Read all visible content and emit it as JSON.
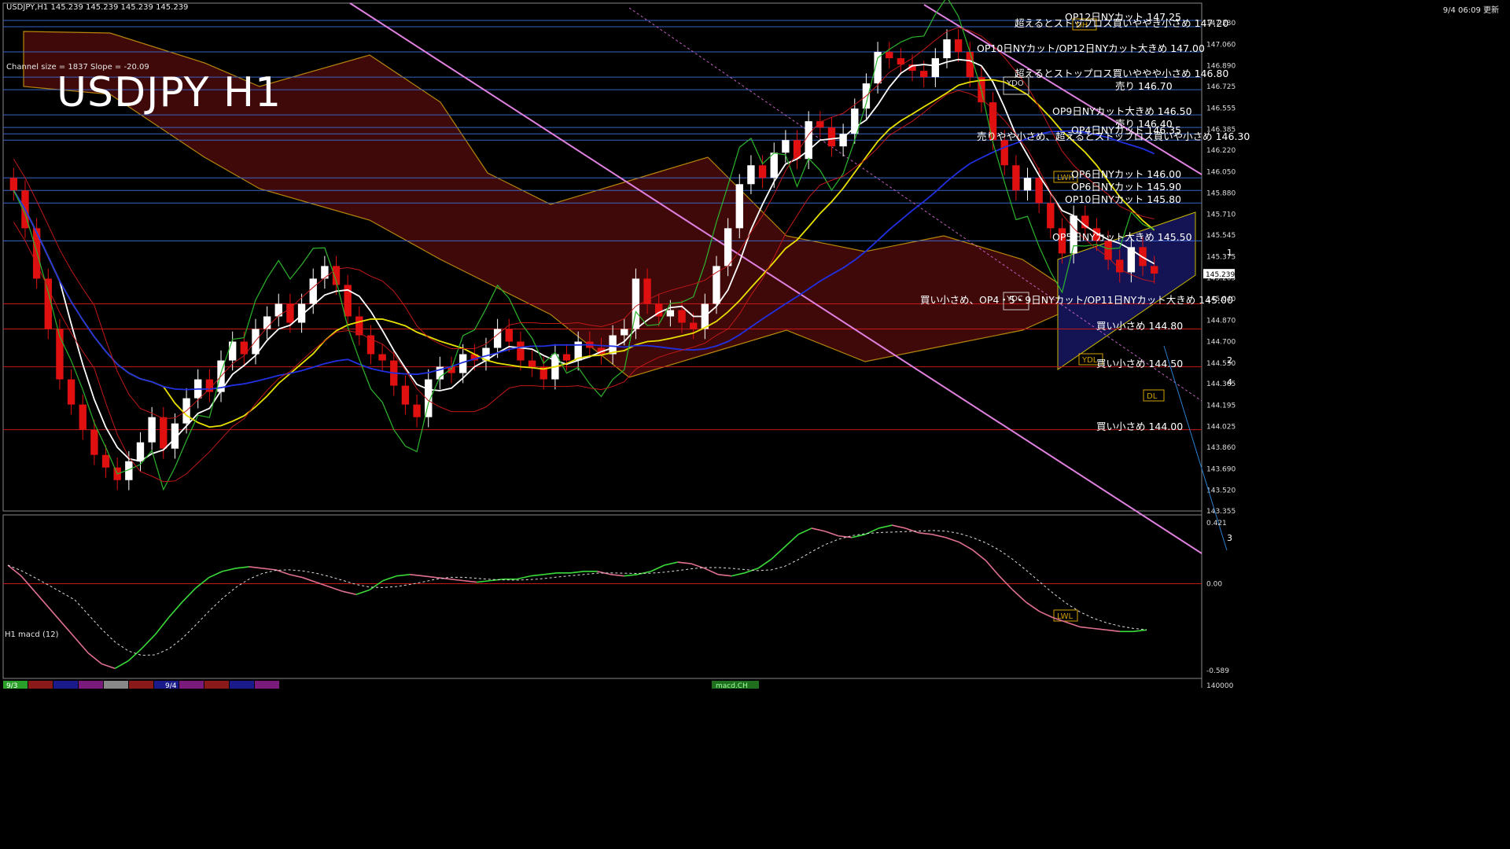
{
  "header": {
    "symbol_info": "USDJPY,H1  145.239 145.239 145.239 145.239",
    "channel_info": "Channel size = 1837 Slope = -20.09",
    "big_title": "USDJPY H1",
    "time_stamp": "9/4 06:09 更新"
  },
  "macd": {
    "label": "H1 macd (12)",
    "scale_top": "0.421",
    "scale_zero": "0.00",
    "scale_bottom": "-0.589",
    "ticks_right": "140000"
  },
  "price_axis": {
    "labels": [
      "147.230",
      "147.060",
      "146.890",
      "146.725",
      "146.555",
      "146.385",
      "146.220",
      "146.050",
      "145.880",
      "145.710",
      "145.545",
      "145.375",
      "145.205",
      "145.040",
      "144.870",
      "144.700",
      "144.530",
      "144.365",
      "144.195",
      "144.025",
      "143.860",
      "143.690",
      "143.520",
      "143.355"
    ],
    "current": "145.239"
  },
  "dates": [
    "9/3",
    "9/4"
  ],
  "bottom_tag": "macd.CH",
  "levels": [
    {
      "text": "OP12日NYカット 147.25",
      "price": 147.25
    },
    {
      "text": "超えるとストップロス買いややき小さめ 147.20",
      "price": 147.2
    },
    {
      "text": "OP10日NYカット/OP12日NYカット大きめ 147.00",
      "price": 147.0
    },
    {
      "text": "超えるとストップロス買いややや小さめ 146.80",
      "price": 146.8
    },
    {
      "text": "売り 146.70",
      "price": 146.7
    },
    {
      "text": "OP9日NYカット大きめ 146.50",
      "price": 146.5
    },
    {
      "text": "売り 146.40",
      "price": 146.4
    },
    {
      "text": "OP4日NYカット 146.35",
      "price": 146.35
    },
    {
      "text": "売りやや小さめ、超えるとストップロス買いや小さめ 146.30",
      "price": 146.3
    },
    {
      "text": "OP6日NYカット 146.00",
      "price": 146.0
    },
    {
      "text": "OP6日NYカット 145.90",
      "price": 145.9
    },
    {
      "text": "OP10日NYカット 145.80",
      "price": 145.8
    },
    {
      "text": "OP5日NYカット大きめ 145.50",
      "price": 145.5
    },
    {
      "text": "買い小さめ、OP4・5・9日NYカット/OP11日NYカット大きめ 145.00",
      "price": 145.0
    },
    {
      "text": "買い小さめ 144.80",
      "price": 144.8
    },
    {
      "text": "買い小さめ 144.50",
      "price": 144.5
    },
    {
      "text": "買い小さめ 144.00",
      "price": 144.0
    }
  ],
  "markers": {
    "ydo": "YDO",
    "ydc": "YDC",
    "ydl": "YDL",
    "dh": "DH",
    "dl": "DL",
    "wh": "LWH",
    "wl": "LWL",
    "proj": [
      "1",
      "2",
      "3",
      "4"
    ]
  },
  "chart_data": {
    "type": "candlestick",
    "title": "USDJPY H1",
    "ylim": [
      143.355,
      147.3
    ],
    "close": [
      145.9,
      145.6,
      145.2,
      144.8,
      144.4,
      144.2,
      144.0,
      143.8,
      143.7,
      143.6,
      143.75,
      143.9,
      144.1,
      143.85,
      144.05,
      144.25,
      144.4,
      144.3,
      144.55,
      144.7,
      144.6,
      144.8,
      144.9,
      145.0,
      144.85,
      145.0,
      145.2,
      145.3,
      145.15,
      144.9,
      144.75,
      144.6,
      144.55,
      144.35,
      144.2,
      144.1,
      144.4,
      144.5,
      144.45,
      144.6,
      144.55,
      144.65,
      144.8,
      144.7,
      144.55,
      144.5,
      144.4,
      144.6,
      144.55,
      144.7,
      144.65,
      144.6,
      144.75,
      144.8,
      145.2,
      145.0,
      144.9,
      144.95,
      144.85,
      144.8,
      145.0,
      145.3,
      145.6,
      145.95,
      146.1,
      146.0,
      146.2,
      146.3,
      146.15,
      146.45,
      146.4,
      146.25,
      146.35,
      146.55,
      146.75,
      147.0,
      146.95,
      146.9,
      146.85,
      146.8,
      146.95,
      147.1,
      147.0,
      146.8,
      146.6,
      146.3,
      146.1,
      145.9,
      146.0,
      145.8,
      145.6,
      145.4,
      145.7,
      145.6,
      145.5,
      145.35,
      145.25,
      145.45,
      145.3,
      145.24
    ],
    "macd": [
      0.12,
      0.05,
      -0.05,
      -0.15,
      -0.25,
      -0.35,
      -0.45,
      -0.52,
      -0.55,
      -0.5,
      -0.42,
      -0.33,
      -0.22,
      -0.12,
      -0.03,
      0.04,
      0.08,
      0.1,
      0.11,
      0.1,
      0.09,
      0.06,
      0.04,
      0.01,
      -0.02,
      -0.05,
      -0.07,
      -0.04,
      0.02,
      0.05,
      0.06,
      0.05,
      0.04,
      0.03,
      0.02,
      0.01,
      0.02,
      0.03,
      0.03,
      0.05,
      0.06,
      0.07,
      0.07,
      0.08,
      0.08,
      0.06,
      0.05,
      0.06,
      0.08,
      0.12,
      0.14,
      0.13,
      0.1,
      0.06,
      0.05,
      0.07,
      0.1,
      0.16,
      0.24,
      0.32,
      0.36,
      0.34,
      0.31,
      0.3,
      0.32,
      0.36,
      0.38,
      0.36,
      0.33,
      0.32,
      0.3,
      0.27,
      0.22,
      0.15,
      0.05,
      -0.04,
      -0.12,
      -0.18,
      -0.22,
      -0.25,
      -0.28,
      -0.29,
      -0.3,
      -0.31,
      -0.31,
      -0.3
    ]
  }
}
